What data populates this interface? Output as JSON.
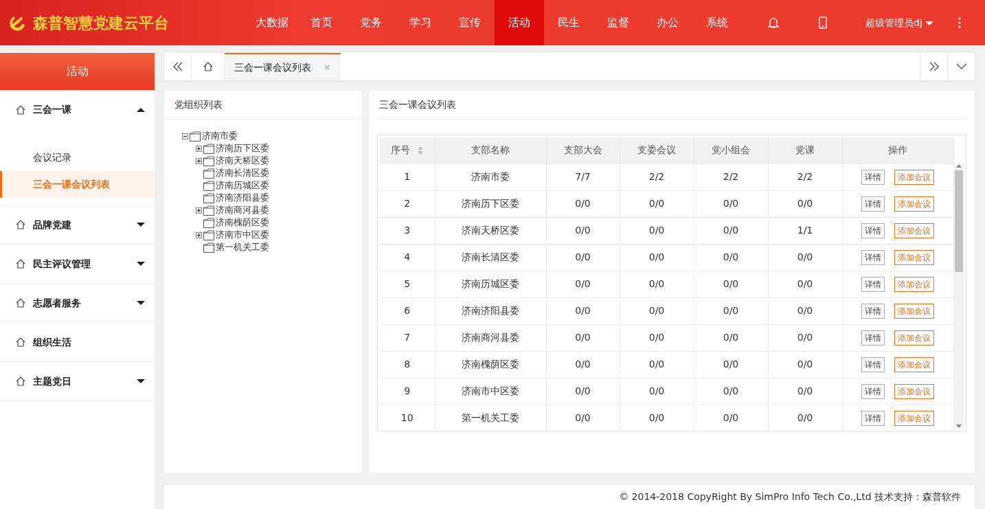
{
  "header": {
    "title": "森普智慧党建云平台",
    "nav": [
      {
        "label": "大数据",
        "selected": false
      },
      {
        "label": "首页",
        "selected": false
      },
      {
        "label": "党务",
        "selected": false
      },
      {
        "label": "学习",
        "selected": false
      },
      {
        "label": "宣传",
        "selected": false
      },
      {
        "label": "活动",
        "selected": true
      },
      {
        "label": "民生",
        "selected": false
      },
      {
        "label": "监督",
        "selected": false
      },
      {
        "label": "办公",
        "selected": false
      },
      {
        "label": "系统",
        "selected": false
      }
    ],
    "user": "超级管理员dj"
  },
  "sidebar": {
    "title": "活动",
    "menu": [
      {
        "label": "三会一课",
        "kind": "group",
        "expanded": true,
        "children": [
          {
            "label": "会议记录",
            "selected": false
          },
          {
            "label": "三会一课会议列表",
            "selected": true
          }
        ]
      },
      {
        "label": "品牌党建",
        "kind": "group",
        "expanded": false
      },
      {
        "label": "民主评议管理",
        "kind": "group",
        "expanded": false
      },
      {
        "label": "志愿者服务",
        "kind": "group",
        "expanded": false
      },
      {
        "label": "组织生活",
        "kind": "link"
      },
      {
        "label": "主题党日",
        "kind": "group",
        "expanded": false
      }
    ]
  },
  "tabs": [
    {
      "label": "三会一课会议列表",
      "selected": true,
      "close": "×"
    }
  ],
  "tree_panel": {
    "title": "党组织列表",
    "tree": [
      {
        "label": "济南市委",
        "expanded": true,
        "children": [
          {
            "label": "济南历下区委",
            "expanded": false
          },
          {
            "label": "济南天桥区委",
            "expanded": false
          },
          {
            "label": "济南长清区委"
          },
          {
            "label": "济南历城区委"
          },
          {
            "label": "济南济阳县委"
          },
          {
            "label": "济南商河县委",
            "expanded": false
          },
          {
            "label": "济南槐荫区委"
          },
          {
            "label": "济南市中区委",
            "expanded": false
          },
          {
            "label": "第一机关工委"
          }
        ]
      }
    ]
  },
  "table_panel": {
    "title": "三会一课会议列表",
    "columns": [
      {
        "label": "序号",
        "sortable": true
      },
      {
        "label": "支部名称",
        "sortable": false
      },
      {
        "label": "支部大会",
        "sortable": false
      },
      {
        "label": "支委会议",
        "sortable": false
      },
      {
        "label": "党小组会",
        "sortable": false
      },
      {
        "label": "党课",
        "sortable": false
      },
      {
        "label": "操作",
        "sortable": false
      }
    ],
    "rows": [
      {
        "cells": [
          "1",
          "济南市委",
          "7/7",
          "2/2",
          "2/2",
          "2/2"
        ],
        "actions": [
          "详情",
          "添加会议"
        ]
      },
      {
        "cells": [
          "2",
          "济南历下区委",
          "0/0",
          "0/0",
          "0/0",
          "0/0"
        ],
        "actions": [
          "详情",
          "添加会议"
        ]
      },
      {
        "cells": [
          "3",
          "济南天桥区委",
          "0/0",
          "0/0",
          "0/0",
          "1/1"
        ],
        "actions": [
          "详情",
          "添加会议"
        ]
      },
      {
        "cells": [
          "4",
          "济南长清区委",
          "0/0",
          "0/0",
          "0/0",
          "0/0"
        ],
        "actions": [
          "详情",
          "添加会议"
        ]
      },
      {
        "cells": [
          "5",
          "济南历城区委",
          "0/0",
          "0/0",
          "0/0",
          "0/0"
        ],
        "actions": [
          "详情",
          "添加会议"
        ]
      },
      {
        "cells": [
          "6",
          "济南济阳县委",
          "0/0",
          "0/0",
          "0/0",
          "0/0"
        ],
        "actions": [
          "详情",
          "添加会议"
        ]
      },
      {
        "cells": [
          "7",
          "济南商河县委",
          "0/0",
          "0/0",
          "0/0",
          "0/0"
        ],
        "actions": [
          "详情",
          "添加会议"
        ]
      },
      {
        "cells": [
          "8",
          "济南槐荫区委",
          "0/0",
          "0/0",
          "0/0",
          "0/0"
        ],
        "actions": [
          "详情",
          "添加会议"
        ]
      },
      {
        "cells": [
          "9",
          "济南市中区委",
          "0/0",
          "0/0",
          "0/0",
          "0/0"
        ],
        "actions": [
          "详情",
          "添加会议"
        ]
      },
      {
        "cells": [
          "10",
          "第一机关工委",
          "0/0",
          "0/0",
          "0/0",
          "0/0"
        ],
        "actions": [
          "详情",
          "添加会议"
        ]
      }
    ]
  },
  "footer": "© 2014-2018 CopyRight By SimPro Info Tech Co.,Ltd 技术支持：森普软件"
}
